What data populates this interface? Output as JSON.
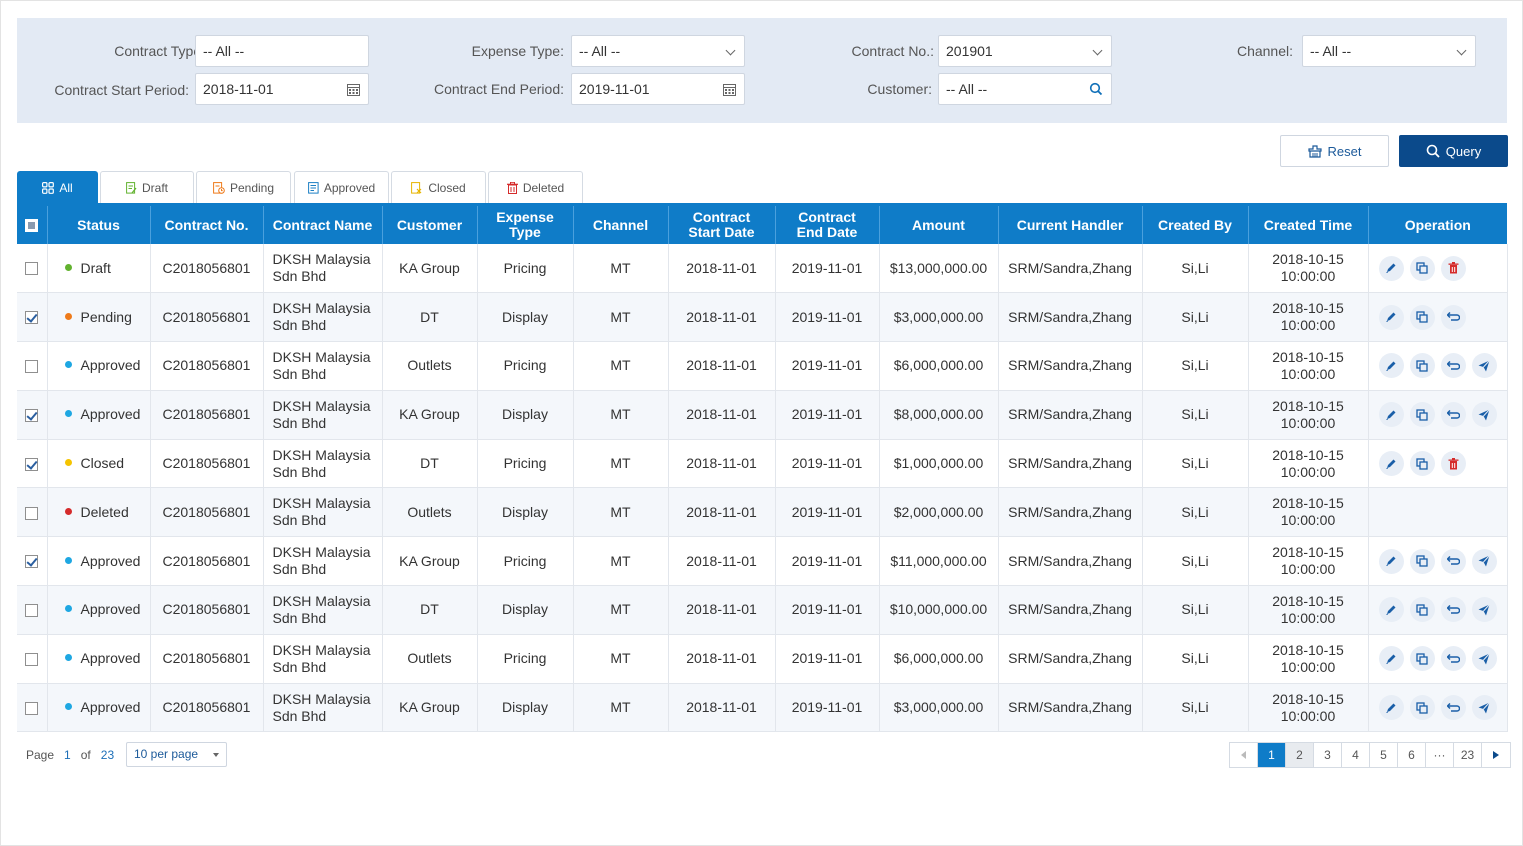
{
  "filters": {
    "contract_type": {
      "label": "Contract Type:",
      "value": "-- All --"
    },
    "expense_type": {
      "label": "Expense Type:",
      "value": "-- All --"
    },
    "contract_no": {
      "label": "Contract No.:",
      "value": "201901"
    },
    "channel": {
      "label": "Channel:",
      "value": "-- All --"
    },
    "start_period": {
      "label": "Contract Start Period:",
      "value": "2018-11-01"
    },
    "end_period": {
      "label": "Contract End Period:",
      "value": "2019-11-01"
    },
    "customer": {
      "label": "Customer:",
      "value": "-- All --"
    }
  },
  "buttons": {
    "reset": "Reset",
    "query": "Query"
  },
  "tabs": [
    "All",
    "Draft",
    "Pending",
    "Approved",
    "Closed",
    "Deleted"
  ],
  "columns": [
    "Status",
    "Contract No.",
    "Contract Name",
    "Customer",
    "Expense Type",
    "Channel",
    "Contract Start Date",
    "Contract End Date",
    "Amount",
    "Current Handler",
    "Created By",
    "Created Time",
    "Operation"
  ],
  "status_colors": {
    "Draft": "#62b22f",
    "Pending": "#ee7a1a",
    "Approved": "#1ea7e2",
    "Closed": "#f5c400",
    "Deleted": "#d52b2b"
  },
  "rows": [
    {
      "checked": false,
      "status": "Draft",
      "no": "C2018056801",
      "name1": "DKSH Malaysia",
      "name2": "Sdn Bhd",
      "customer": "KA Group",
      "expense": "Pricing",
      "channel": "MT",
      "start": "2018-11-01",
      "end": "2019-11-01",
      "amount": "$13,000,000.00",
      "handler": "SRM/Sandra,Zhang",
      "by": "Si,Li",
      "date": "2018-10-15",
      "time": "10:00:00",
      "ops": [
        "edit",
        "copy",
        "delete"
      ]
    },
    {
      "checked": true,
      "status": "Pending",
      "no": "C2018056801",
      "name1": "DKSH Malaysia",
      "name2": "Sdn Bhd",
      "customer": "DT",
      "expense": "Display",
      "channel": "MT",
      "start": "2018-11-01",
      "end": "2019-11-01",
      "amount": "$3,000,000.00",
      "handler": "SRM/Sandra,Zhang",
      "by": "Si,Li",
      "date": "2018-10-15",
      "time": "10:00:00",
      "ops": [
        "edit",
        "copy",
        "withdraw"
      ]
    },
    {
      "checked": false,
      "status": "Approved",
      "no": "C2018056801",
      "name1": "DKSH Malaysia",
      "name2": "Sdn Bhd",
      "customer": "Outlets",
      "expense": "Pricing",
      "channel": "MT",
      "start": "2018-11-01",
      "end": "2019-11-01",
      "amount": "$6,000,000.00",
      "handler": "SRM/Sandra,Zhang",
      "by": "Si,Li",
      "date": "2018-10-15",
      "time": "10:00:00",
      "ops": [
        "edit",
        "copy",
        "withdraw",
        "send"
      ]
    },
    {
      "checked": true,
      "status": "Approved",
      "no": "C2018056801",
      "name1": "DKSH Malaysia",
      "name2": "Sdn Bhd",
      "customer": "KA Group",
      "expense": "Display",
      "channel": "MT",
      "start": "2018-11-01",
      "end": "2019-11-01",
      "amount": "$8,000,000.00",
      "handler": "SRM/Sandra,Zhang",
      "by": "Si,Li",
      "date": "2018-10-15",
      "time": "10:00:00",
      "ops": [
        "edit",
        "copy",
        "withdraw",
        "send"
      ]
    },
    {
      "checked": true,
      "status": "Closed",
      "no": "C2018056801",
      "name1": "DKSH Malaysia",
      "name2": "Sdn Bhd",
      "customer": "DT",
      "expense": "Pricing",
      "channel": "MT",
      "start": "2018-11-01",
      "end": "2019-11-01",
      "amount": "$1,000,000.00",
      "handler": "SRM/Sandra,Zhang",
      "by": "Si,Li",
      "date": "2018-10-15",
      "time": "10:00:00",
      "ops": [
        "edit",
        "copy",
        "delete"
      ]
    },
    {
      "checked": false,
      "status": "Deleted",
      "no": "C2018056801",
      "name1": "DKSH Malaysia",
      "name2": "Sdn Bhd",
      "customer": "Outlets",
      "expense": "Display",
      "channel": "MT",
      "start": "2018-11-01",
      "end": "2019-11-01",
      "amount": "$2,000,000.00",
      "handler": "SRM/Sandra,Zhang",
      "by": "Si,Li",
      "date": "2018-10-15",
      "time": "10:00:00",
      "ops": []
    },
    {
      "checked": true,
      "status": "Approved",
      "no": "C2018056801",
      "name1": "DKSH Malaysia",
      "name2": "Sdn Bhd",
      "customer": "KA Group",
      "expense": "Pricing",
      "channel": "MT",
      "start": "2018-11-01",
      "end": "2019-11-01",
      "amount": "$11,000,000.00",
      "handler": "SRM/Sandra,Zhang",
      "by": "Si,Li",
      "date": "2018-10-15",
      "time": "10:00:00",
      "ops": [
        "edit",
        "copy",
        "withdraw",
        "send"
      ]
    },
    {
      "checked": false,
      "status": "Approved",
      "no": "C2018056801",
      "name1": "DKSH Malaysia",
      "name2": "Sdn Bhd",
      "customer": "DT",
      "expense": "Display",
      "channel": "MT",
      "start": "2018-11-01",
      "end": "2019-11-01",
      "amount": "$10,000,000.00",
      "handler": "SRM/Sandra,Zhang",
      "by": "Si,Li",
      "date": "2018-10-15",
      "time": "10:00:00",
      "ops": [
        "edit",
        "copy",
        "withdraw",
        "send"
      ]
    },
    {
      "checked": false,
      "status": "Approved",
      "no": "C2018056801",
      "name1": "DKSH Malaysia",
      "name2": "Sdn Bhd",
      "customer": "Outlets",
      "expense": "Pricing",
      "channel": "MT",
      "start": "2018-11-01",
      "end": "2019-11-01",
      "amount": "$6,000,000.00",
      "handler": "SRM/Sandra,Zhang",
      "by": "Si,Li",
      "date": "2018-10-15",
      "time": "10:00:00",
      "ops": [
        "edit",
        "copy",
        "withdraw",
        "send"
      ]
    },
    {
      "checked": false,
      "status": "Approved",
      "no": "C2018056801",
      "name1": "DKSH Malaysia",
      "name2": "Sdn Bhd",
      "customer": "KA Group",
      "expense": "Display",
      "channel": "MT",
      "start": "2018-11-01",
      "end": "2019-11-01",
      "amount": "$3,000,000.00",
      "handler": "SRM/Sandra,Zhang",
      "by": "Si,Li",
      "date": "2018-10-15",
      "time": "10:00:00",
      "ops": [
        "edit",
        "copy",
        "withdraw",
        "send"
      ]
    }
  ],
  "pagination": {
    "page_label": "Page",
    "current": "1",
    "of_label": "of",
    "total": "23",
    "per_page": "10 per page",
    "pages": [
      "1",
      "2",
      "3",
      "4",
      "5",
      "6",
      "···",
      "23"
    ]
  },
  "colors": {
    "primary": "#0f7cc8",
    "dark_primary": "#0b4a8b",
    "filter_bg": "#e3eaf4"
  }
}
